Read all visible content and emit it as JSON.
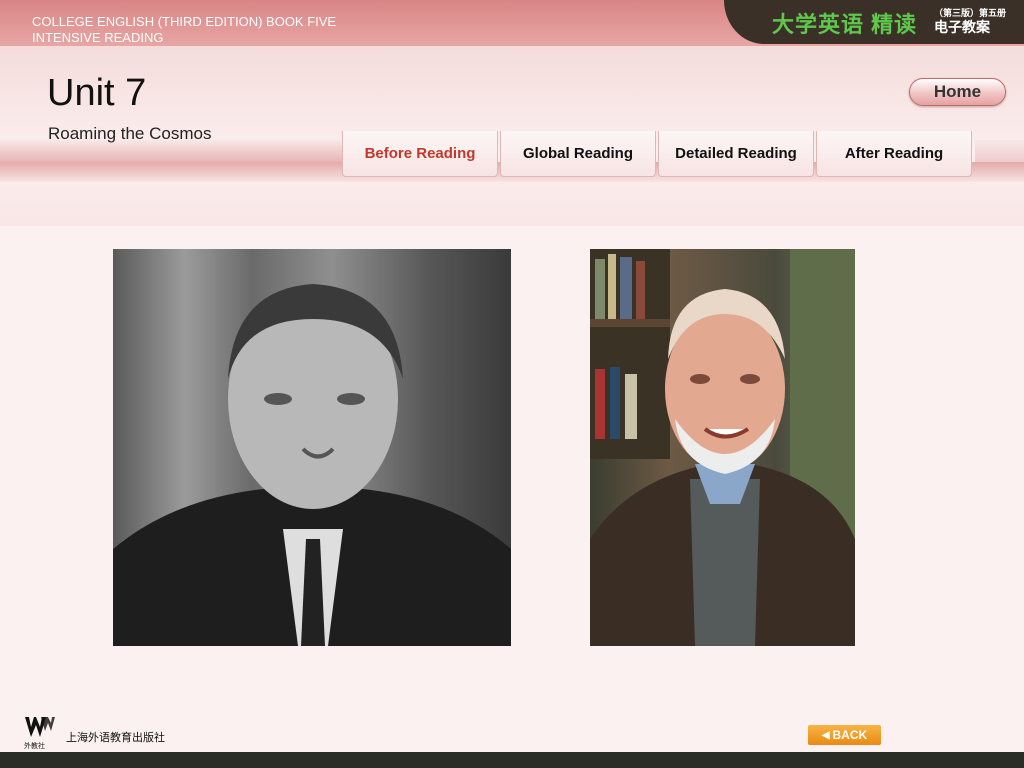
{
  "header": {
    "series_line1": "COLLEGE ENGLISH (THIRD EDITION) BOOK FIVE",
    "series_line2": "INTENSIVE READING",
    "logo_cn": "大学英语 精读",
    "logo_edition": "（第三版）第五册",
    "logo_courseware": "电子教案"
  },
  "unit": {
    "title": "Unit 7",
    "subtitle": "Roaming the Cosmos"
  },
  "home_label": "Home",
  "tabs": [
    {
      "label": "Before Reading",
      "active": true
    },
    {
      "label": "Global Reading",
      "active": false
    },
    {
      "label": "Detailed Reading",
      "active": false
    },
    {
      "label": "After Reading",
      "active": false
    }
  ],
  "footer": {
    "publisher_name": "上海外语教育出版社",
    "publisher_short": "外教社",
    "back_label": "BACK"
  },
  "icons": {
    "back": "left-arrow-icon"
  },
  "colors": {
    "active_tab": "#c0392b",
    "logo_green": "#5ec84b",
    "back_button": "#ea8a12"
  }
}
